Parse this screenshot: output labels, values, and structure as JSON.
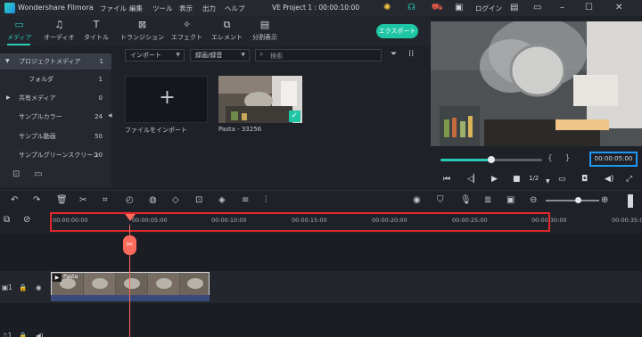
{
  "titlebar": {
    "app_name": "Wondershare Filmora",
    "menus": [
      "ファイル",
      "編集",
      "ツール",
      "表示",
      "出力",
      "ヘルプ"
    ],
    "project_title": "VE Project 1 : 00:00:10:00",
    "login": "ログイン",
    "accent_color": "#27c8b6"
  },
  "toolbar": {
    "tools": [
      {
        "label": "メディア",
        "icon": "folder-icon"
      },
      {
        "label": "オーディオ",
        "icon": "music-note-icon"
      },
      {
        "label": "タイトル",
        "icon": "text-icon"
      },
      {
        "label": "トランジション",
        "icon": "transition-icon"
      },
      {
        "label": "エフェクト",
        "icon": "effects-icon"
      },
      {
        "label": "エレメント",
        "icon": "elements-icon"
      },
      {
        "label": "分割表示",
        "icon": "split-screen-icon"
      }
    ],
    "export_label": "エクスポート"
  },
  "sidebar": {
    "items": [
      {
        "label": "プロジェクトメディア",
        "count": "1"
      },
      {
        "label": "フォルダ",
        "count": "1"
      },
      {
        "label": "共有メディア",
        "count": "0"
      },
      {
        "label": "サンプルカラー",
        "count": "24"
      },
      {
        "label": "サンプル動画",
        "count": "50"
      },
      {
        "label": "サンプルグリーンスクリーン",
        "count": "10"
      }
    ]
  },
  "media": {
    "import_dropdown": "インポート",
    "record_dropdown": "録画/録音",
    "search_placeholder": "検索",
    "import_tile_label": "ファイルをインポート",
    "clip_label": "Pasta - 33256"
  },
  "player": {
    "timecode": "00:00:05:00",
    "speed": "1/2",
    "progress": 0.5
  },
  "timeline": {
    "ruler_ticks": [
      "00:00:00:00",
      "00:00:05:00",
      "00:00:10:00",
      "00:00:15:00",
      "00:00:20:00",
      "00:00:25:00",
      "00:00:30:00",
      "00:00:35:0"
    ],
    "clip_label": "Pasta"
  }
}
